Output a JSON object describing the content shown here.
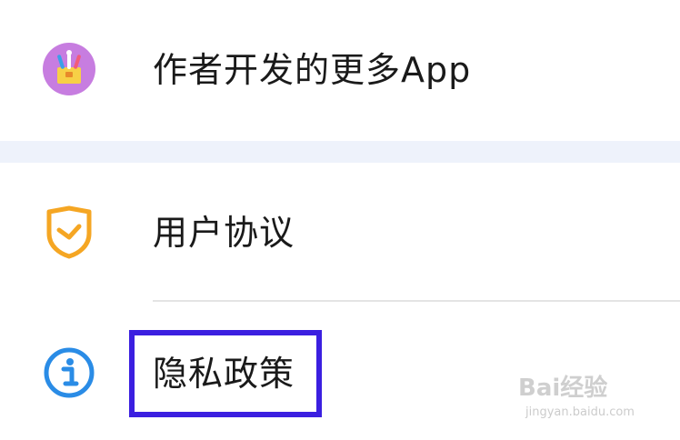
{
  "settings": {
    "items": [
      {
        "label": "作者开发的更多App",
        "icon": "toolbox-icon"
      },
      {
        "label": "用户协议",
        "icon": "shield-check-icon"
      },
      {
        "label": "隐私政策",
        "icon": "info-icon"
      }
    ]
  },
  "annotation": {
    "highlight_color": "#3b1fe0"
  },
  "watermark": {
    "brand": "Bai经验",
    "url": "jingyan.baidu.com"
  },
  "colors": {
    "section_gap": "#eef2fb",
    "divider": "#e4e4e4",
    "shield": "#f5a623",
    "info": "#2a8ce6",
    "toolbox_bg": "#c77de0"
  }
}
